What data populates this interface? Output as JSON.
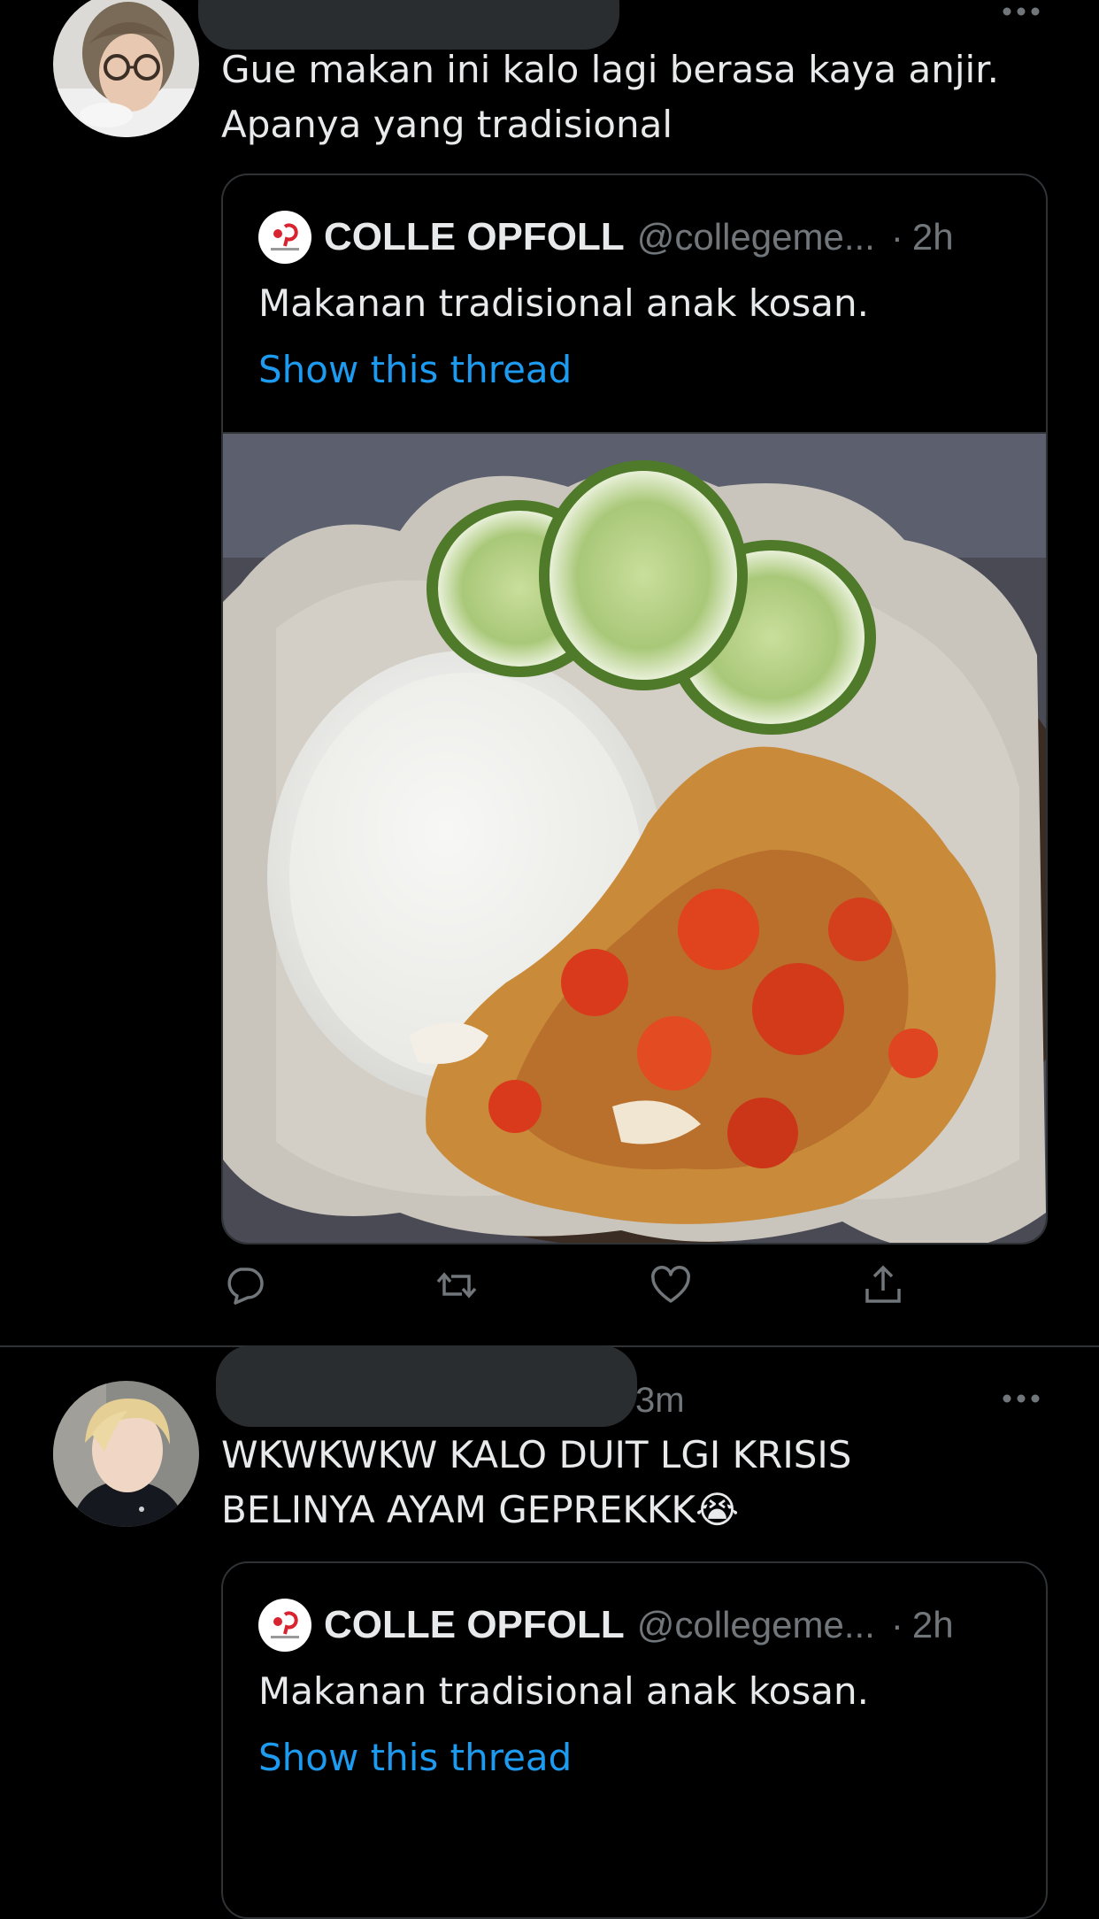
{
  "tweets": [
    {
      "text": "Gue makan ini kalo lagi berasa kaya anjir.\nApanya yang tradisional",
      "quote": {
        "name": "COLLE OPFOLL",
        "handle": "@collegeme...",
        "separator": "·",
        "time": "2h",
        "text": "Makanan tradisional anak kosan.",
        "show_thread": "Show this thread",
        "media": "photo: rice, fried chicken with sambal, cucumber slices on paper-lined plate"
      },
      "actions": [
        "reply-icon",
        "retweet-icon",
        "like-icon",
        "share-icon"
      ]
    },
    {
      "time": "3m",
      "text": "WKWKWKW KALO DUIT LGI KRISIS\nBELINYA AYAM GEPREKKK😭",
      "quote": {
        "name": "COLLE OPFOLL",
        "handle": "@collegeme...",
        "separator": "·",
        "time": "2h",
        "text": "Makanan tradisional anak kosan.",
        "show_thread": "Show this thread"
      }
    }
  ],
  "colors": {
    "background": "#000000",
    "text": "#e7e9ea",
    "secondary": "#71767b",
    "link": "#1d9bf0",
    "border": "#2f3336"
  }
}
